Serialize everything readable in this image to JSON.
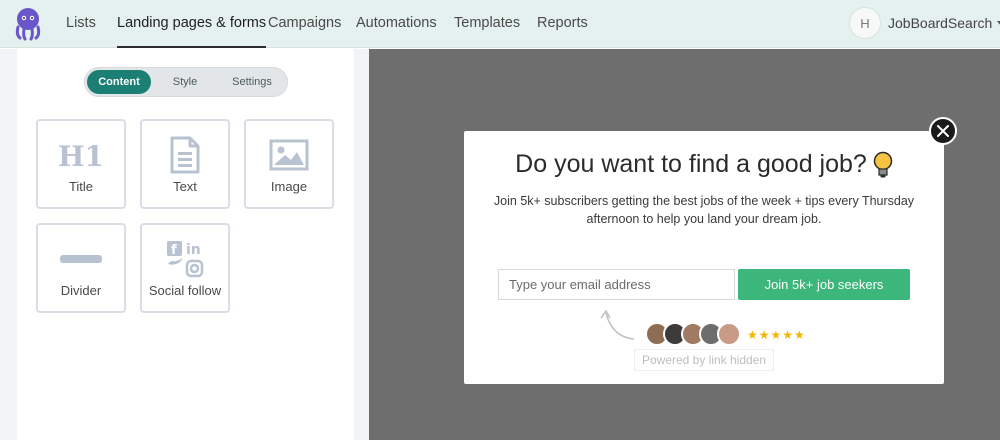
{
  "nav": {
    "items": [
      {
        "label": "Lists"
      },
      {
        "label": "Landing pages & forms",
        "active": true
      },
      {
        "label": "Campaigns"
      },
      {
        "label": "Automations"
      },
      {
        "label": "Templates"
      },
      {
        "label": "Reports"
      }
    ],
    "account": {
      "initial": "H",
      "name": "JobBoardSearch"
    }
  },
  "editor": {
    "tabs": [
      {
        "label": "Content",
        "active": true
      },
      {
        "label": "Style"
      },
      {
        "label": "Settings"
      }
    ],
    "blocks": [
      {
        "label": "Title",
        "icon": "h1-icon"
      },
      {
        "label": "Text",
        "icon": "document-icon"
      },
      {
        "label": "Image",
        "icon": "image-icon"
      },
      {
        "label": "Divider",
        "icon": "divider-icon"
      },
      {
        "label": "Social follow",
        "icon": "social-icons"
      }
    ]
  },
  "popup": {
    "title": "Do you want to find a good job?",
    "description": "Join 5k+ subscribers getting the best jobs of the week + tips every Thursday afternoon to help you land your dream job.",
    "email_placeholder": "Type your email address",
    "button_label": "Join 5k+ job seekers",
    "stars": "★★★★★",
    "powered_by": "Powered by link hidden"
  },
  "colors": {
    "accent": "#1c7f74",
    "cta": "#3cb67b",
    "star": "#f5b400",
    "preview_bg": "#6e6e6e"
  }
}
